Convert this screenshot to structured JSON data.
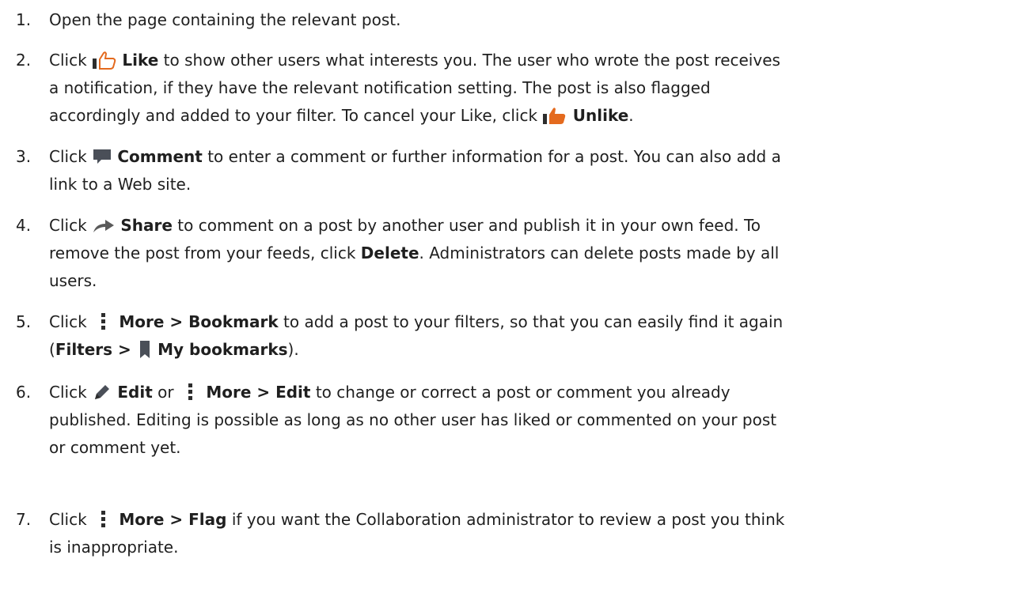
{
  "steps": [
    {
      "num": "1.",
      "lines": [
        "Open the page containing the relevant post."
      ]
    },
    {
      "num": "2.",
      "l1_pre": "Click ",
      "like": "Like",
      "l1_post": " to show other users what interests you. The user who wrote the post receives",
      "l2": "a notification, if they have the relevant notification setting. The post is also flagged",
      "l3_pre": "accordingly and added to your filter. To cancel your Like, click ",
      "unlike": "Unlike",
      "l3_post": "."
    },
    {
      "num": "3.",
      "l1_pre": "Click ",
      "comment": "Comment",
      "l1_post": " to enter a comment or further information for a post. You can also add a",
      "l2": "link to a Web site."
    },
    {
      "num": "4.",
      "l1_pre": "Click ",
      "share": "Share",
      "l1_post": " to comment on a post by another user and publish it in your own feed. To",
      "l2_pre": "remove the post from your feeds, click ",
      "delete": "Delete",
      "l2_post": ". Administrators can delete posts made by all",
      "l3": "users."
    },
    {
      "num": "5.",
      "l1_pre": "Click ",
      "more_bookmark": "More > Bookmark",
      "l1_post": " to add a post to your filters, so that you can easily find it again",
      "l2_open": "(",
      "filters": "Filters > ",
      "my_bookmarks": "My bookmarks",
      "l2_close": ")."
    },
    {
      "num": "6.",
      "l1_pre": "Click ",
      "edit": "Edit",
      "or": " or ",
      "more_edit": "More > Edit",
      "l1_post": " to change or correct a post or comment you already",
      "l2": "published. Editing is possible as long as no other user has liked or commented on your post",
      "l3": "or comment yet."
    },
    {
      "num": "7.",
      "l1_pre": "Click ",
      "more_flag": "More > Flag",
      "l1_post": " if you want the Collaboration administrator to review a post you think",
      "l2": "is inappropriate."
    }
  ],
  "icons": {
    "like": "thumbs-up-outline-icon",
    "unlike": "thumbs-up-filled-icon",
    "comment": "speech-bubble-icon",
    "share": "share-arrow-icon",
    "more": "vertical-ellipsis-icon",
    "bookmark": "bookmark-icon",
    "edit": "pencil-icon"
  },
  "colors": {
    "text": "#1f1f1f",
    "icon": "#2d2d2d",
    "like_accent": "#e46a1e",
    "icon_gray": "#5a5a5a"
  }
}
